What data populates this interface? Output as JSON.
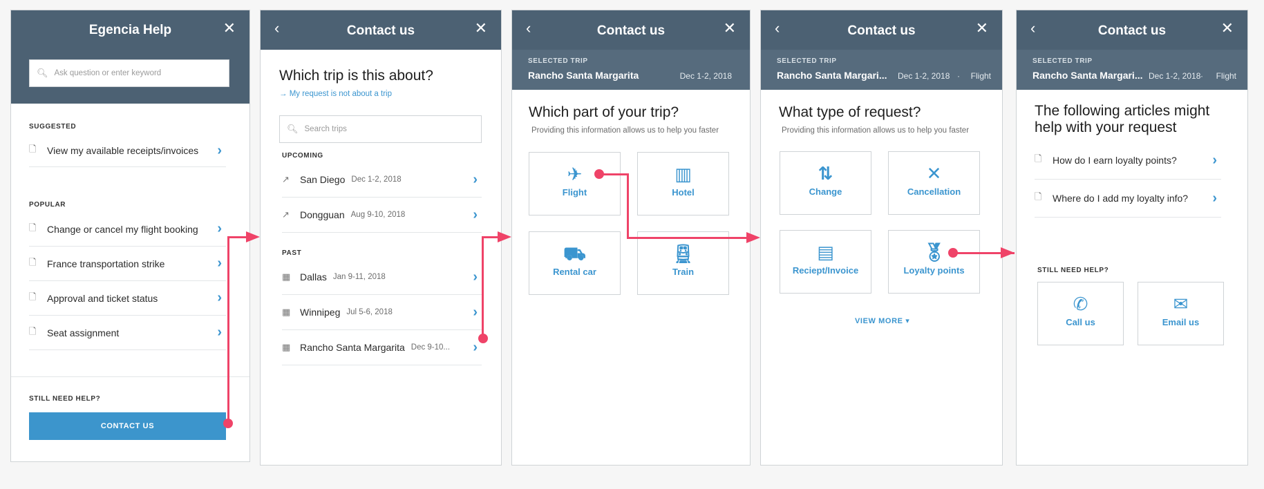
{
  "accent": "#3b95cf",
  "header_color": "#4c6173",
  "connector_color": "#ef4368",
  "p1": {
    "title": "Egencia Help",
    "search_placeholder": "Ask question or enter keyword",
    "suggested_label": "SUGGESTED",
    "suggested": [
      "View my available receipts/invoices"
    ],
    "popular_label": "POPULAR",
    "popular": [
      "Change or cancel my flight booking",
      "France transportation strike",
      "Approval and ticket status",
      "Seat assignment"
    ],
    "still_label": "STILL NEED HELP?",
    "contact_btn": "CONTACT US"
  },
  "p2": {
    "title": "Contact us",
    "heading": "Which trip is this about?",
    "link": "My request is not about a trip",
    "search_placeholder": "Search trips",
    "upcoming_label": "UPCOMING",
    "upcoming": [
      {
        "city": "San Diego",
        "date": "Dec 1-2, 2018"
      },
      {
        "city": "Dongguan",
        "date": "Aug 9-10, 2018"
      }
    ],
    "past_label": "PAST",
    "past": [
      {
        "city": "Dallas",
        "date": "Jan 9-11, 2018"
      },
      {
        "city": "Winnipeg",
        "date": "Jul 5-6, 2018"
      },
      {
        "city": "Rancho Santa Margarita",
        "date": "Dec 9-10..."
      }
    ]
  },
  "p3": {
    "title": "Contact us",
    "sel_label": "SELECTED TRIP",
    "sel_trip": "Rancho Santa Margarita",
    "sel_date": "Dec 1-2, 2018",
    "heading": "Which part of your trip?",
    "hint": "Providing this information allows us to help you faster",
    "tiles": [
      "Flight",
      "Hotel",
      "Rental car",
      "Train"
    ]
  },
  "p4": {
    "title": "Contact us",
    "sel_label": "SELECTED TRIP",
    "sel_trip": "Rancho Santa Margari...",
    "sel_date": "Dec 1-2, 2018",
    "sel_sep": "·",
    "sel_type": "Flight",
    "heading": "What type of request?",
    "hint": "Providing this information allows us to help you faster",
    "tiles": [
      "Change",
      "Cancellation",
      "Reciept/Invoice",
      "Loyalty points"
    ],
    "view_more": "VIEW MORE"
  },
  "p5": {
    "title": "Contact us",
    "sel_label": "SELECTED TRIP",
    "sel_trip": "Rancho Santa Margari...",
    "sel_date": "Dec 1-2, 2018",
    "sel_sep": "·",
    "sel_type": "Flight",
    "heading1": "The following articles might",
    "heading2": "help with your request",
    "articles": [
      "How do I earn loyalty points?",
      "Where do I add my loyalty info?"
    ],
    "still_label": "STILL NEED HELP?",
    "tiles": [
      "Call us",
      "Email us"
    ]
  }
}
